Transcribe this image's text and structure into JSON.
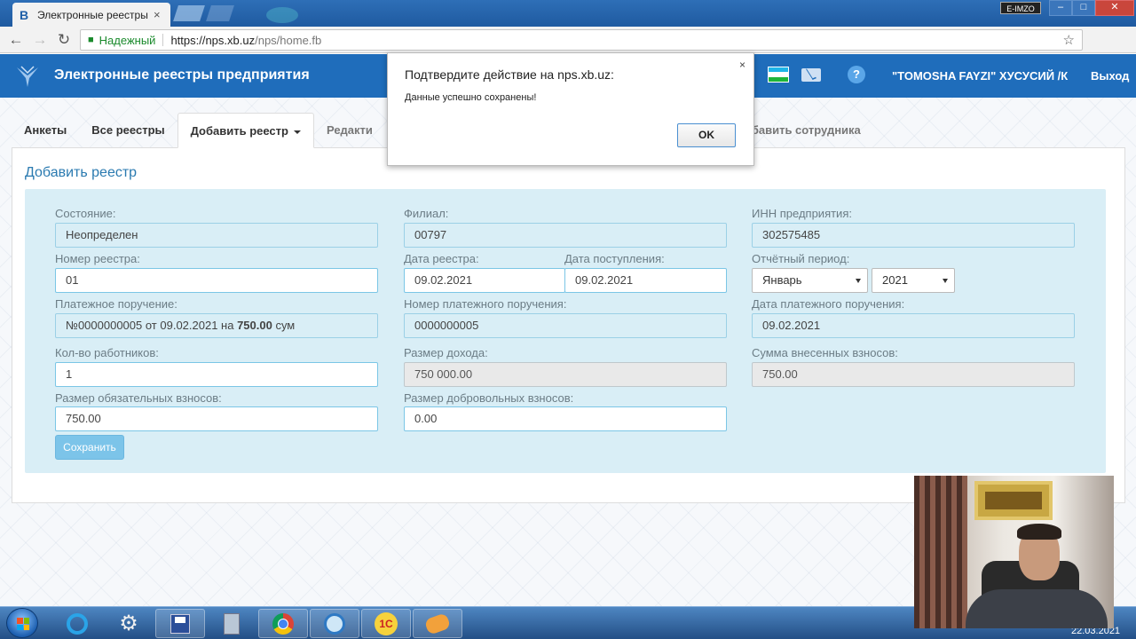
{
  "browser": {
    "tab_title": "Электронные реестры п",
    "tab_close": "×",
    "secure_label": "Надежный",
    "url_host": "https://nps.xb.uz",
    "url_path": "/nps/home.fb",
    "eimzo": "E-IMZO",
    "win_minimize": "–",
    "win_maximize": "□",
    "win_close": "✕"
  },
  "header": {
    "title": "Электронные реестры предприятия",
    "company": "\"TOMOSHA FAYZI\" ХУСУСИЙ /К",
    "logout": "Выход",
    "help": "?",
    "flag_colors": [
      "#1eb5e8",
      "#ffffff",
      "#1eb53a"
    ]
  },
  "tabs": [
    {
      "label": "Анкеты"
    },
    {
      "label": "Все реестры"
    },
    {
      "label": "Добавить реестр",
      "active": true
    },
    {
      "label": "Редакти"
    },
    {
      "label": "обавить сотрудника"
    }
  ],
  "panel": {
    "title": "Добавить реестр",
    "save_label": "Сохранить"
  },
  "form": {
    "state_label": "Состояние:",
    "state_value": "Неопределен",
    "branch_label": "Филиал:",
    "branch_value": "00797",
    "inn_label": "ИНН предприятия:",
    "inn_value": "302575485",
    "reg_number_label": "Номер реестра:",
    "reg_number_value": "01",
    "reg_date_label": "Дата реестра:",
    "reg_date_value": "09.02.2021",
    "receipt_date_label": "Дата поступления:",
    "receipt_date_value": "09.02.2021",
    "period_label": "Отчётный период:",
    "period_month": "Январь",
    "period_year": "2021",
    "payment_order_label": "Платежное поручение:",
    "payment_order_prefix": "№0000000005 от 09.02.2021 на ",
    "payment_order_amount": "750.00",
    "payment_order_suffix": " сум",
    "payment_number_label": "Номер платежного поручения:",
    "payment_number_value": "0000000005",
    "payment_date_label": "Дата платежного поручения:",
    "payment_date_value": "09.02.2021",
    "workers_label": "Кол-во работников:",
    "workers_value": "1",
    "income_label": "Размер дохода:",
    "income_value": "750 000.00",
    "paid_sum_label": "Сумма внесенных взносов:",
    "paid_sum_value": "750.00",
    "mandatory_label": "Размер обязательных взносов:",
    "mandatory_value": "750.00",
    "voluntary_label": "Размер добровольных взносов:",
    "voluntary_value": "0.00"
  },
  "dialog": {
    "title": "Подтвердите действие на nps.xb.uz:",
    "message": "Данные успешно сохранены!",
    "ok_label": "OK",
    "close": "×"
  },
  "taskbar": {
    "clock": "22.03.2021",
    "onec_label": "1С"
  }
}
